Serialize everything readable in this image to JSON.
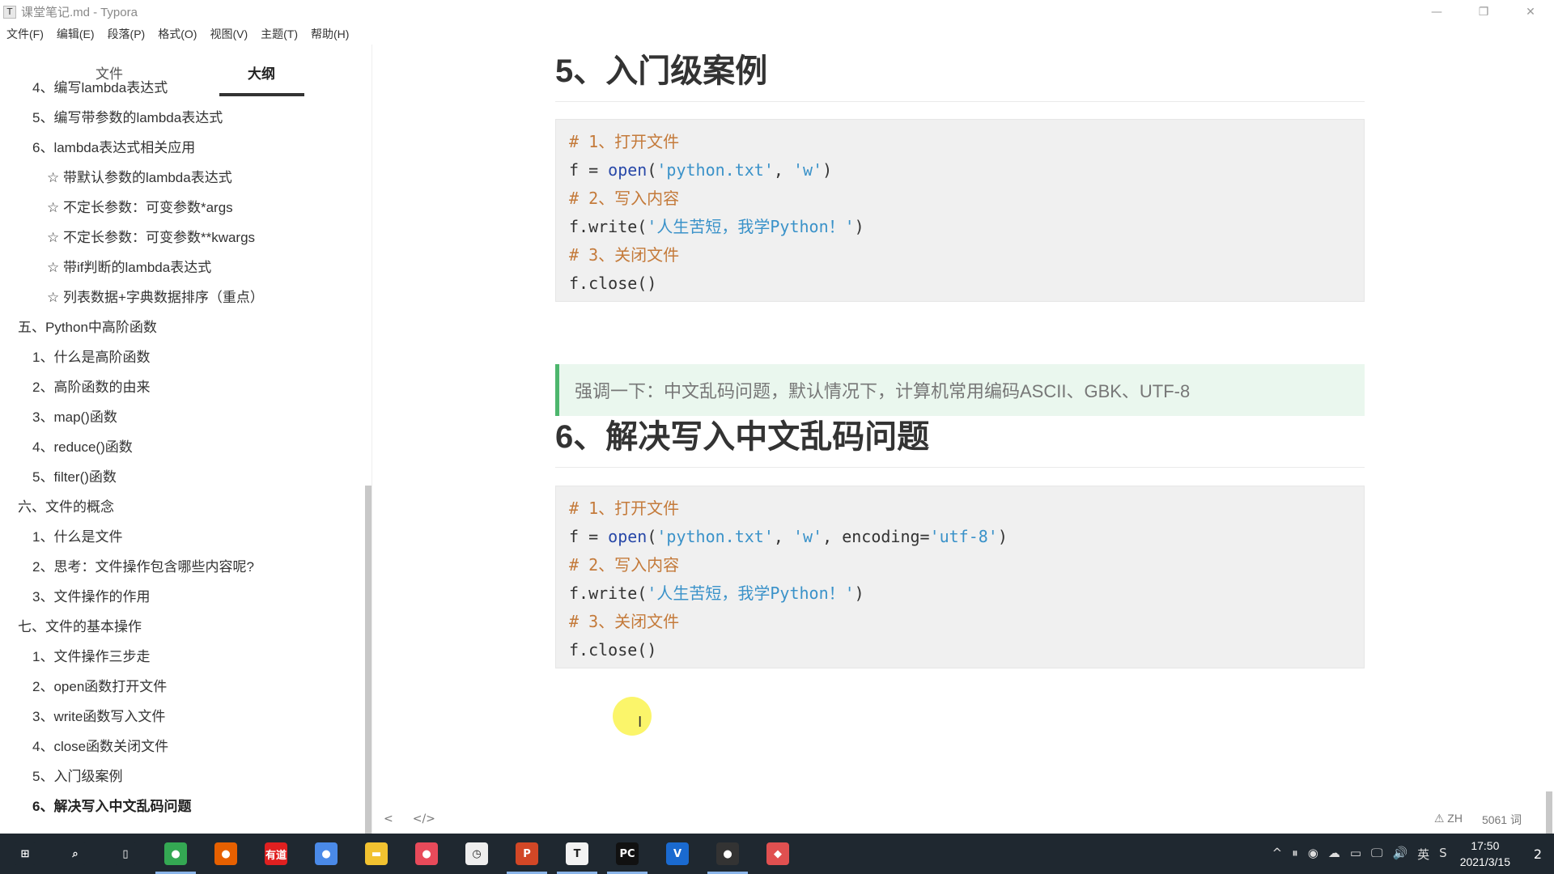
{
  "window": {
    "icon_letter": "T",
    "title": "课堂笔记.md - Typora",
    "minimize": "—",
    "restore": "❐",
    "close": "✕"
  },
  "menu": [
    "文件(F)",
    "编辑(E)",
    "段落(P)",
    "格式(O)",
    "视图(V)",
    "主题(T)",
    "帮助(H)"
  ],
  "sidebar": {
    "tabs": [
      "文件",
      "大纲"
    ],
    "active_tab": "大纲",
    "outline": [
      {
        "text": "4、编写lambda表达式",
        "level": 2
      },
      {
        "text": "5、编写带参数的lambda表达式",
        "level": 2
      },
      {
        "text": "6、lambda表达式相关应用",
        "level": 2
      },
      {
        "text": "☆ 带默认参数的lambda表达式",
        "level": 3
      },
      {
        "text": "☆ 不定长参数：可变参数*args",
        "level": 3
      },
      {
        "text": "☆ 不定长参数：可变参数**kwargs",
        "level": 3
      },
      {
        "text": "☆ 带if判断的lambda表达式",
        "level": 3
      },
      {
        "text": "☆ 列表数据+字典数据排序（重点）",
        "level": 3
      },
      {
        "text": "五、Python中高阶函数",
        "level": 1
      },
      {
        "text": "1、什么是高阶函数",
        "level": 2
      },
      {
        "text": "2、高阶函数的由来",
        "level": 2
      },
      {
        "text": "3、map()函数",
        "level": 2
      },
      {
        "text": "4、reduce()函数",
        "level": 2
      },
      {
        "text": "5、filter()函数",
        "level": 2
      },
      {
        "text": "六、文件的概念",
        "level": 1
      },
      {
        "text": "1、什么是文件",
        "level": 2
      },
      {
        "text": "2、思考：文件操作包含哪些内容呢?",
        "level": 2
      },
      {
        "text": "3、文件操作的作用",
        "level": 2
      },
      {
        "text": "七、文件的基本操作",
        "level": 1
      },
      {
        "text": "1、文件操作三步走",
        "level": 2
      },
      {
        "text": "2、open函数打开文件",
        "level": 2
      },
      {
        "text": "3、write函数写入文件",
        "level": 2
      },
      {
        "text": "4、close函数关闭文件",
        "level": 2
      },
      {
        "text": "5、入门级案例",
        "level": 2
      },
      {
        "text": "6、解决写入中文乱码问题",
        "level": 2,
        "active": true
      }
    ]
  },
  "doc": {
    "heading1": "5、入门级案例",
    "code1": {
      "c1": "# 1、打开文件",
      "l2a": "f = ",
      "l2kw": "open",
      "l2b": "(",
      "l2s1": "'python.txt'",
      "l2c": ", ",
      "l2s2": "'w'",
      "l2d": ")",
      "c3": "# 2、写入内容",
      "l4a": "f.write(",
      "l4s": "'人生苦短，我学Python！'",
      "l4b": ")",
      "c5": "# 3、关闭文件",
      "l6": "f.close()"
    },
    "quote": "强调一下：中文乱码问题，默认情况下，计算机常用编码ASCII、GBK、UTF-8",
    "heading2": "6、解决写入中文乱码问题",
    "code2": {
      "c1": "# 1、打开文件",
      "l2a": "f = ",
      "l2kw": "open",
      "l2b": "(",
      "l2s1": "'python.txt'",
      "l2c": ", ",
      "l2s2": "'w'",
      "l2d": ", encoding=",
      "l2s3": "'utf-8'",
      "l2e": ")",
      "c3": "# 2、写入内容",
      "l4a": "f.write(",
      "l4s": "'人生苦短，我学Python！'",
      "l4b": ")",
      "c5": "# 3、关闭文件",
      "l6": "f.close()"
    }
  },
  "statusbar": {
    "back": "<",
    "source": "</>",
    "lang": "⚠ ZH",
    "words": "5061 词"
  },
  "taskbar": {
    "apps": [
      {
        "name": "start",
        "glyph": "⊞",
        "color": "#1f2830"
      },
      {
        "name": "search",
        "glyph": "⌕",
        "color": "#1f2830"
      },
      {
        "name": "task-view",
        "glyph": "▯",
        "color": "#1f2830"
      },
      {
        "name": "chrome",
        "glyph": "●",
        "color": "#34a853",
        "running": true
      },
      {
        "name": "firefox",
        "glyph": "●",
        "color": "#e66000"
      },
      {
        "name": "youdao",
        "glyph": "有道",
        "color": "#e02020"
      },
      {
        "name": "chromium",
        "glyph": "●",
        "color": "#4a8ae8"
      },
      {
        "name": "file-explorer",
        "glyph": "▬",
        "color": "#f2c230"
      },
      {
        "name": "screen-recorder",
        "glyph": "●",
        "color": "#e84a5a"
      },
      {
        "name": "clock-app",
        "glyph": "◷",
        "color": "#eeeeee"
      },
      {
        "name": "powerpoint",
        "glyph": "P",
        "color": "#d24726",
        "running": true
      },
      {
        "name": "typora",
        "glyph": "T",
        "color": "#f2f2f2",
        "running": true
      },
      {
        "name": "pycharm",
        "glyph": "PC",
        "color": "#111111",
        "running": true
      },
      {
        "name": "vpn",
        "glyph": "V",
        "color": "#1a6ad0"
      },
      {
        "name": "recorder",
        "glyph": "●",
        "color": "#333333",
        "running": true
      },
      {
        "name": "eraser-app",
        "glyph": "◆",
        "color": "#e05050"
      }
    ],
    "tray": [
      "^",
      "⏸",
      "◉",
      "☁",
      "▭",
      "🖵",
      "🔊",
      "英",
      "S"
    ],
    "time": "17:50",
    "date": "2021/3/15",
    "notification": "2"
  }
}
